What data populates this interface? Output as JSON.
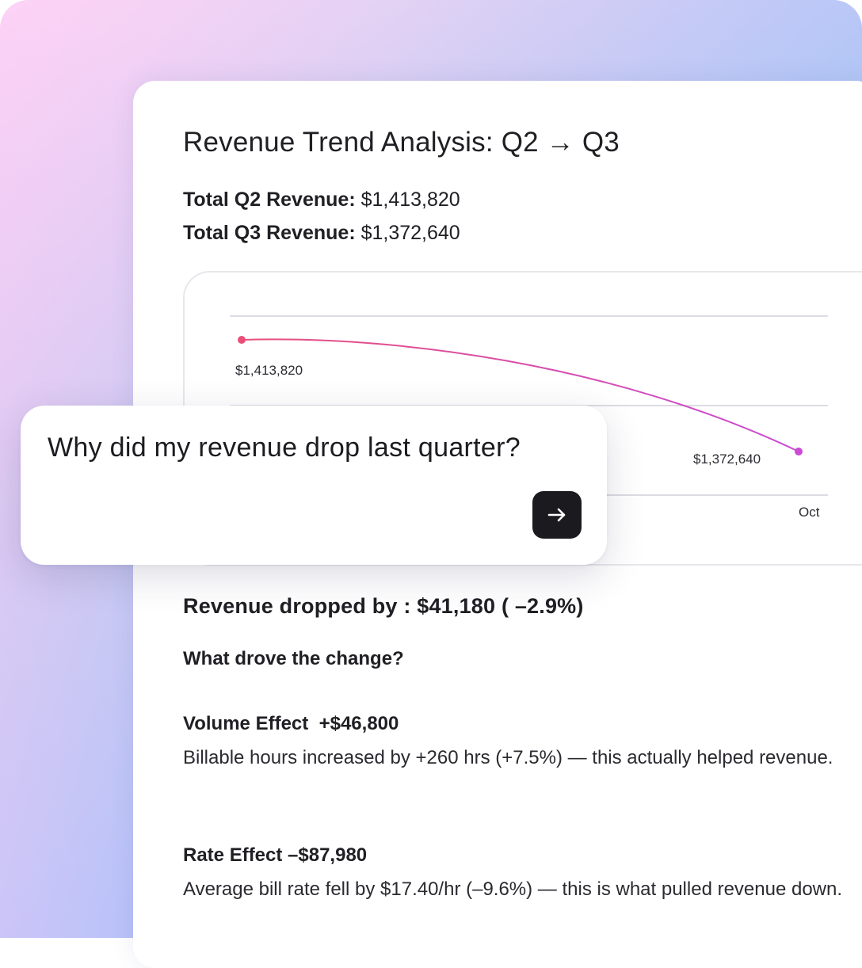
{
  "report": {
    "title": "Revenue Trend Analysis: Q2 → Q3",
    "q2_label": "Total Q2 Revenue:",
    "q2_value": " $1,413,820",
    "q3_label": "Total Q3 Revenue:",
    "q3_value": " $1,372,640"
  },
  "chart_data": {
    "type": "line",
    "x": [
      "",
      "Oct"
    ],
    "values": [
      1413820,
      1372640
    ],
    "point_labels": [
      "$1,413,820",
      "$1,372,640"
    ],
    "x_tick_labels": [
      "Oct"
    ],
    "grid": true,
    "colors": [
      "#e8507a",
      "#c94bd6"
    ]
  },
  "prompt": {
    "text": "Why did my revenue drop last quarter?",
    "send_icon": "arrow-right-icon"
  },
  "summary": {
    "drop": "Revenue dropped by : $41,180 ( –2.9%)",
    "drivers_heading": "What drove the change?"
  },
  "effects": {
    "volume_heading": "Volume Effect  +$46,800",
    "volume_text": "Billable hours increased by +260 hrs (+7.5%) — this actually helped revenue.",
    "rate_heading": "Rate Effect –$87,980",
    "rate_text": "Average bill rate fell by $17.40/hr (–9.6%) — this is what pulled revenue down."
  }
}
